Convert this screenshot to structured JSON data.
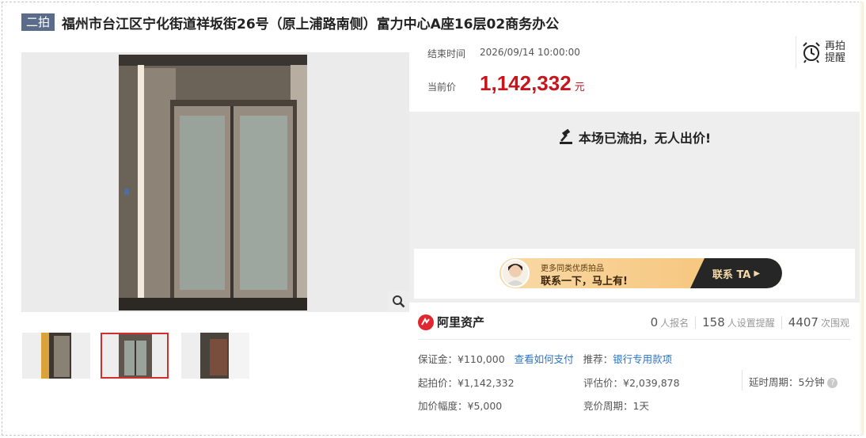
{
  "title": {
    "badge": "二拍",
    "text": "福州市台江区宁化街道祥坂街26号（原上浦路南侧）富力中心A座16层02商务办公"
  },
  "auction": {
    "end_label": "结束时间",
    "end_time": "2026/09/14 10:00:00",
    "remind_label": "再拍提醒",
    "price_label": "当前价",
    "price_value": "1,142,332",
    "price_unit": "元",
    "status": "本场已流拍，无人出价!"
  },
  "banner": {
    "small": "更多同类优质拍品",
    "big": "联系一下，马上有!",
    "button": "联系 TA"
  },
  "platform": {
    "name": "阿里资产",
    "applicants": "0",
    "applicants_label": "人报名",
    "reminders": "158",
    "reminders_label": "人设置提醒",
    "views": "4407",
    "views_label": "次围观"
  },
  "details": {
    "deposit": "保证金：¥110,000",
    "how_to_pay": "查看如何支付",
    "recommend_label": "推荐：",
    "recommend_value": "银行专用款项",
    "start_price": "起拍价：¥1,142,332",
    "assessed_price": "评估价：¥2,039,878",
    "delay_period": "延时周期：5分钟",
    "increment": "加价幅度：¥5,000",
    "bid_period": "竞价周期：1天"
  },
  "icons": {
    "zoom": "magnifier-icon",
    "alarm": "alarm-clock-icon",
    "gavel": "gavel-icon",
    "logo": "ali-assets-logo-icon",
    "help": "question-icon"
  },
  "colors": {
    "price": "#c4161c",
    "badge": "#5a6c8a",
    "link": "#2a74c8",
    "accent": "#d12f2f"
  }
}
